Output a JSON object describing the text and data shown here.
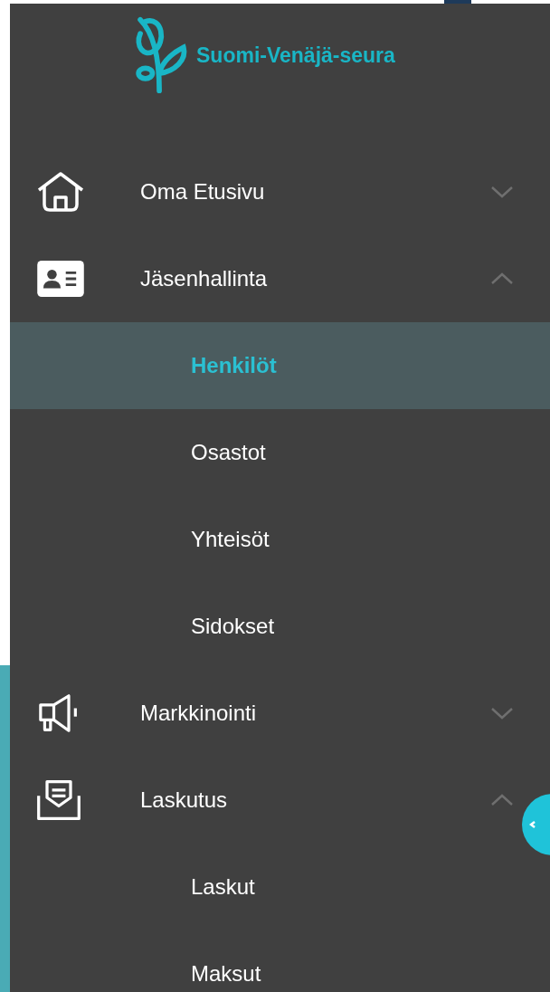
{
  "logo": {
    "text": "Suomi-Venäjä-seura"
  },
  "menu": [
    {
      "label": "Oma Etusivu",
      "expanded": false
    },
    {
      "label": "Jäsenhallinta",
      "expanded": true,
      "children": [
        {
          "label": "Henkilöt",
          "selected": true
        },
        {
          "label": "Osastot",
          "selected": false
        },
        {
          "label": "Yhteisöt",
          "selected": false
        },
        {
          "label": "Sidokset",
          "selected": false
        }
      ]
    },
    {
      "label": "Markkinointi",
      "expanded": false
    },
    {
      "label": "Laskutus",
      "expanded": true,
      "children": [
        {
          "label": "Laskut",
          "selected": false
        },
        {
          "label": "Maksut",
          "selected": false
        }
      ]
    }
  ]
}
